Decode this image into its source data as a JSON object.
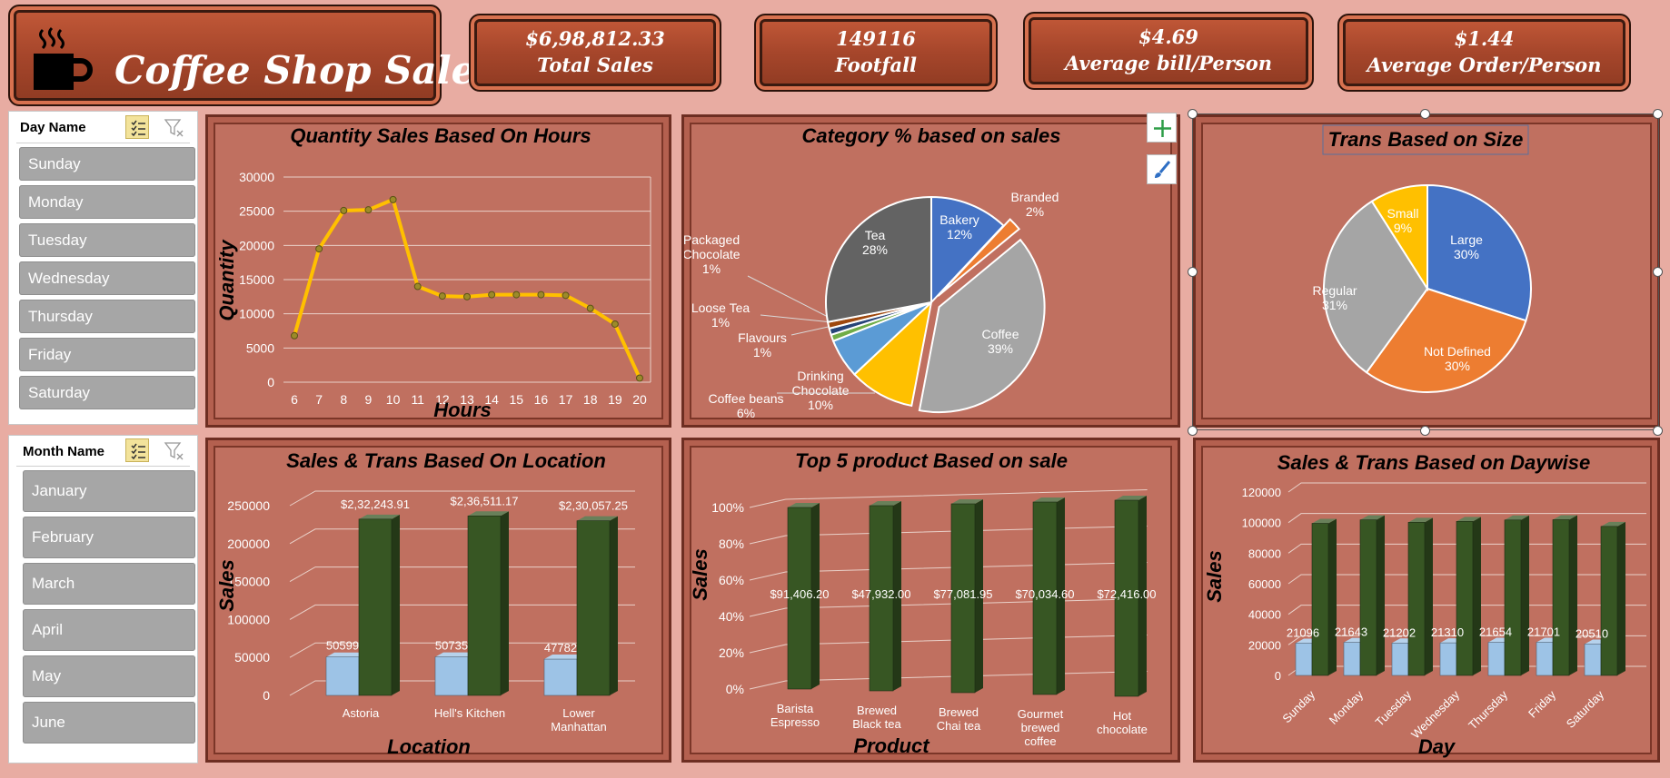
{
  "title": "Coffee Shop Sales",
  "kpis": [
    {
      "value": "$6,98,812.33",
      "label": "Total Sales"
    },
    {
      "value": "149116",
      "label": "Footfall"
    },
    {
      "value": "$4.69",
      "label": "Average bill/Person"
    },
    {
      "value": "$1.44",
      "label": "Average Order/Person"
    }
  ],
  "day_slicer": {
    "title": "Day Name",
    "items": [
      "Sunday",
      "Monday",
      "Tuesday",
      "Wednesday",
      "Thursday",
      "Friday",
      "Saturday"
    ]
  },
  "month_slicer": {
    "title": "Month Name",
    "items": [
      "January",
      "February",
      "March",
      "April",
      "May",
      "June"
    ]
  },
  "chart_data": [
    {
      "type": "line",
      "title": "Quantity Sales Based On Hours",
      "xlabel": "Hours",
      "ylabel": "Quantity",
      "x": [
        6,
        7,
        8,
        9,
        10,
        11,
        12,
        13,
        14,
        15,
        16,
        17,
        18,
        19,
        20
      ],
      "values": [
        6800,
        19500,
        25100,
        25200,
        26700,
        14000,
        12600,
        12500,
        12800,
        12800,
        12800,
        12700,
        10800,
        8500,
        600
      ],
      "ylim": [
        0,
        30000
      ],
      "yticks": [
        0,
        5000,
        10000,
        15000,
        20000,
        25000,
        30000
      ],
      "color": "#ffc000"
    },
    {
      "type": "pie",
      "title": "Category % based on sales",
      "slices": [
        {
          "name": "Bakery",
          "pct": "12%",
          "value": 12,
          "color": "#4472c4"
        },
        {
          "name": "Branded",
          "pct": "2%",
          "value": 2,
          "color": "#ed7d31"
        },
        {
          "name": "Coffee",
          "pct": "39%",
          "value": 39,
          "color": "#a5a5a5"
        },
        {
          "name": "Drinking Chocolate",
          "pct": "10%",
          "value": 10,
          "color": "#ffc000"
        },
        {
          "name": "Coffee beans",
          "pct": "6%",
          "value": 6,
          "color": "#5b9bd5"
        },
        {
          "name": "Flavours",
          "pct": "1%",
          "value": 1,
          "color": "#70ad47"
        },
        {
          "name": "Loose Tea",
          "pct": "1%",
          "value": 1,
          "color": "#264478"
        },
        {
          "name": "Packaged Chocolate",
          "pct": "1%",
          "value": 1,
          "color": "#9e480e"
        },
        {
          "name": "Tea",
          "pct": "28%",
          "value": 28,
          "color": "#636363"
        }
      ]
    },
    {
      "type": "pie",
      "title": "Trans Based on Size",
      "slices": [
        {
          "name": "Large",
          "pct": "30%",
          "value": 30,
          "color": "#4472c4"
        },
        {
          "name": "Not Defined",
          "pct": "30%",
          "value": 30,
          "color": "#ed7d31"
        },
        {
          "name": "Regular",
          "pct": "31%",
          "value": 31,
          "color": "#a5a5a5"
        },
        {
          "name": "Small",
          "pct": "9%",
          "value": 9,
          "color": "#ffc000"
        }
      ]
    },
    {
      "type": "bar",
      "title": "Sales & Trans Based On Location",
      "xlabel": "Location",
      "ylabel": "Sales",
      "categories": [
        "Astoria",
        "Hell's Kitchen",
        "Lower Manhattan"
      ],
      "series": [
        {
          "values": [
            50599,
            50735,
            47782
          ],
          "labels": [
            "50599",
            "50735",
            "47782"
          ],
          "color": "#9dc3e6"
        },
        {
          "values": [
            232243.91,
            236511.17,
            230057.25
          ],
          "labels": [
            "$2,32,243.91",
            "$2,36,511.17",
            "$2,30,057.25"
          ],
          "color": "#375623"
        }
      ],
      "ylim": [
        0,
        250000
      ],
      "yticks": [
        0,
        50000,
        100000,
        150000,
        200000,
        250000
      ]
    },
    {
      "type": "bar",
      "title": "Top 5 product Based on sale",
      "xlabel": "Product",
      "ylabel": "Sales",
      "categories": [
        "Barista Espresso",
        "Brewed Black tea",
        "Brewed Chai tea",
        "Gourmet brewed coffee",
        "Hot chocolate"
      ],
      "series": [
        {
          "values": [
            100,
            100,
            100,
            100,
            100
          ],
          "labels": [
            "$91,406.20",
            "$47,932.00",
            "$77,081.95",
            "$70,034.60",
            "$72,416.00"
          ],
          "color": "#375623"
        }
      ],
      "yticks": [
        "0%",
        "20%",
        "40%",
        "60%",
        "80%",
        "100%"
      ]
    },
    {
      "type": "bar",
      "title": "Sales & Trans Based on Daywise",
      "xlabel": "Day",
      "ylabel": "Sales",
      "categories": [
        "Sunday",
        "Monday",
        "Tuesday",
        "Wednesday",
        "Thursday",
        "Friday",
        "Saturday"
      ],
      "series": [
        {
          "values": [
            21096,
            21643,
            21202,
            21310,
            21654,
            21701,
            20510
          ],
          "labels": [
            "21096",
            "21643",
            "21202",
            "21310",
            "21654",
            "21701",
            "20510"
          ],
          "color": "#9dc3e6"
        },
        {
          "values": [
            99500,
            101800,
            100200,
            100800,
            101700,
            101900,
            97500
          ],
          "color": "#375623"
        }
      ],
      "ylim": [
        0,
        120000
      ],
      "yticks": [
        0,
        20000,
        40000,
        60000,
        80000,
        100000,
        120000
      ]
    }
  ]
}
